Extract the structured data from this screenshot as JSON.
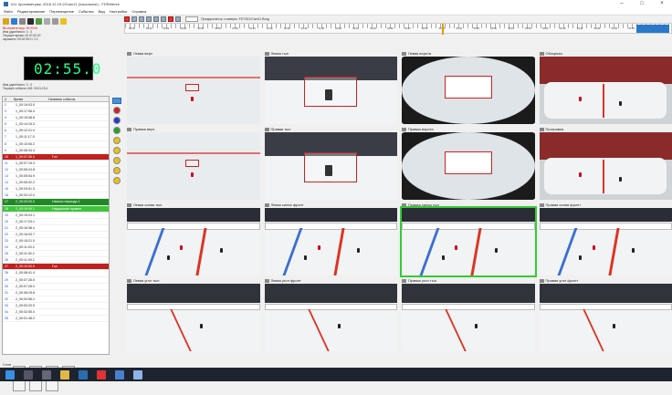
{
  "window": {
    "title": "#11 Хронометраж: 2018.12.19-2/Cam11 (локальное) - FDReferee",
    "buttons": [
      "–",
      "□",
      "×"
    ]
  },
  "menu": [
    "Файл",
    "Редактирование",
    "Перемещение",
    "События",
    "Вид",
    "Настройки",
    "Справка"
  ],
  "timeline": {
    "description": "Предпросмотр с камеры: FD7331/Cam11 Вход",
    "tick_labels": [
      "00:00",
      "00:10",
      "00:20",
      "00:30",
      "00:40",
      "00:50",
      "01:00",
      "01:10",
      "01:20",
      "01:30",
      "01:40",
      "01:50",
      "02:00",
      "02:10",
      "02:20",
      "02:30",
      "02:40",
      "02:50",
      "03:00",
      "03:10",
      "03:20",
      "03:30",
      "03:40",
      "03:50",
      "04:00",
      "04:10",
      "04:20",
      "04:30",
      "04:40",
      "04:50"
    ]
  },
  "info": {
    "lines_top": [
      "Вы играете игру: 00:00:04",
      "Имя удалённого: 0 - 0",
      "Текущее время: 00:07:00.00",
      "окрашено: 00:02:55.0 / 2.0"
    ],
    "clock": "02:55.0",
    "lines_bottom": [
      "Имя удалённого: 0 - 0",
      "Текущее событие #18: 00:01:19.4"
    ]
  },
  "events": {
    "headers": [
      "#",
      "Время",
      "Название события"
    ],
    "rows": [
      {
        "num": "2",
        "time": "1_00:19:03.0",
        "name": "",
        "style": ""
      },
      {
        "num": "3",
        "time": "1_00:17:06.4",
        "name": "",
        "style": ""
      },
      {
        "num": "4",
        "time": "1_00:15:08.8",
        "name": "",
        "style": ""
      },
      {
        "num": "5",
        "time": "1_00:14:15.3",
        "name": "",
        "style": ""
      },
      {
        "num": "6",
        "time": "1_00:12:21.0",
        "name": "",
        "style": ""
      },
      {
        "num": "7",
        "time": "1_00:11:17.0",
        "name": "",
        "style": ""
      },
      {
        "num": "8",
        "time": "1_00:10:06.2",
        "name": "",
        "style": ""
      },
      {
        "num": "9",
        "time": "1_00:08:34.3",
        "name": "",
        "style": ""
      },
      {
        "num": "10",
        "time": "1_00:07:36.4",
        "name": "Гол",
        "style": "red"
      },
      {
        "num": "11",
        "time": "1_00:07:15.3",
        "name": "",
        "style": ""
      },
      {
        "num": "12",
        "time": "1_00:06:24.8",
        "name": "",
        "style": ""
      },
      {
        "num": "13",
        "time": "1_00:05:54.9",
        "name": "",
        "style": ""
      },
      {
        "num": "14",
        "time": "1_00:05:02.2",
        "name": "",
        "style": ""
      },
      {
        "num": "15",
        "time": "1_00:03:51.3",
        "name": "",
        "style": ""
      },
      {
        "num": "16",
        "time": "1_00:03:12.0",
        "name": "",
        "style": ""
      },
      {
        "num": "17",
        "time": "2_00:20:00.0",
        "name": "Начало периода 2",
        "style": "green"
      },
      {
        "num": "18",
        "time": "2_00:19:09.1",
        "name": "Нарушение правил",
        "style": "lgreen"
      },
      {
        "num": "19",
        "time": "2_00:19:04.1",
        "name": "",
        "style": ""
      },
      {
        "num": "20",
        "time": "2_00:17:03.1",
        "name": "",
        "style": ""
      },
      {
        "num": "21",
        "time": "2_00:16:38.4",
        "name": "",
        "style": ""
      },
      {
        "num": "22",
        "time": "2_00:16:03.7",
        "name": "",
        "style": ""
      },
      {
        "num": "23",
        "time": "2_00:15:21.0",
        "name": "",
        "style": ""
      },
      {
        "num": "24",
        "time": "2_00:11:03.2",
        "name": "",
        "style": ""
      },
      {
        "num": "25",
        "time": "2_00:11:00.2",
        "name": "",
        "style": ""
      },
      {
        "num": "26",
        "time": "2_00:11:09.2",
        "name": "",
        "style": ""
      },
      {
        "num": "27",
        "time": "2_00:10:00.0",
        "name": "Гол",
        "style": "red"
      },
      {
        "num": "28",
        "time": "2_00:08:41.4",
        "name": "",
        "style": ""
      },
      {
        "num": "29",
        "time": "2_00:07:26.0",
        "name": "",
        "style": ""
      },
      {
        "num": "30",
        "time": "2_00:07:26.0",
        "name": "",
        "style": ""
      },
      {
        "num": "31",
        "time": "2_00:06:25.6",
        "name": "",
        "style": ""
      },
      {
        "num": "32",
        "time": "2_00:04:56.2",
        "name": "",
        "style": ""
      },
      {
        "num": "33",
        "time": "2_00:03:20.5",
        "name": "",
        "style": ""
      },
      {
        "num": "34",
        "time": "2_00:02:55.0",
        "name": "",
        "style": ""
      },
      {
        "num": "35",
        "time": "2_00:01:48.2",
        "name": "",
        "style": ""
      }
    ]
  },
  "markers": {
    "colors": [
      "#d42020",
      "#1f3fd0",
      "#22a02c",
      "#e9c21a",
      "#e9c21a",
      "#e9c21a",
      "#e9c21a",
      "#e9c21a"
    ]
  },
  "cameras": [
    {
      "label": "Левая верх",
      "kind": "top"
    },
    {
      "label": "Левая тыл",
      "kind": "goal"
    },
    {
      "label": "Левая ворота",
      "kind": "fisheye"
    },
    {
      "label": "Обзорная",
      "kind": "wide"
    },
    {
      "label": "Правая верх",
      "kind": "top"
    },
    {
      "label": "Правая тыл",
      "kind": "goal"
    },
    {
      "label": "Правая ворота",
      "kind": "fisheye"
    },
    {
      "label": "Програвка",
      "kind": "wide"
    },
    {
      "label": "Левая синяя тыл",
      "kind": "blue"
    },
    {
      "label": "Левая синяя фронт",
      "kind": "blue"
    },
    {
      "label": "Правая синяя тыл",
      "kind": "blue",
      "selected": true
    },
    {
      "label": "Правая синяя фронт",
      "kind": "blue"
    },
    {
      "label": "Левая угол тыл",
      "kind": "corner"
    },
    {
      "label": "Левая угол фронт",
      "kind": "corner"
    },
    {
      "label": "Правая угол тыл",
      "kind": "corner"
    },
    {
      "label": "Правая угол фронт",
      "kind": "corner"
    }
  ],
  "status": "Готов"
}
